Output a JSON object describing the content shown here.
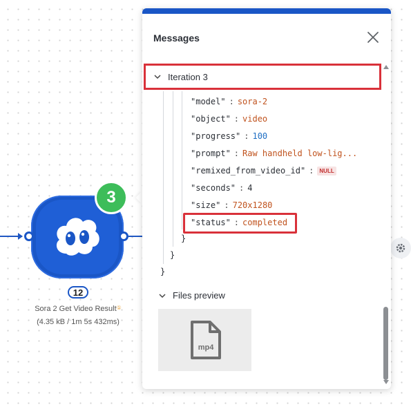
{
  "colors": {
    "accent": "#1a56c6",
    "success_badge": "#3dbd5a",
    "highlight_border": "#d9313a",
    "string_value": "#c0531e",
    "number_value": "#1f6fc4",
    "null_badge": "#c22d2d"
  },
  "module": {
    "badge_count": "3",
    "operations": "12",
    "name": "Sora 2 Get Video Result",
    "info_marker": "①",
    "stats": "(4.35 kB / 1m 5s 432ms)"
  },
  "panel": {
    "title": "Messages",
    "iteration_label": "Iteration 3",
    "fields": [
      {
        "key": "\"model\"",
        "value": "sora-2",
        "kind": "string"
      },
      {
        "key": "\"object\"",
        "value": "video",
        "kind": "string"
      },
      {
        "key": "\"progress\"",
        "value": "100",
        "kind": "number"
      },
      {
        "key": "\"prompt\"",
        "value": "Raw handheld low-lig...",
        "kind": "string"
      },
      {
        "key": "\"remixed_from_video_id\"",
        "value": "NULL",
        "kind": "null"
      },
      {
        "key": "\"seconds\"",
        "value": "4",
        "kind": "plain"
      },
      {
        "key": "\"size\"",
        "value": "720x1280",
        "kind": "string"
      },
      {
        "key": "\"status\"",
        "value": "completed",
        "kind": "string"
      }
    ],
    "brace": "}",
    "files_label": "Files preview",
    "file_ext": "mp4"
  }
}
